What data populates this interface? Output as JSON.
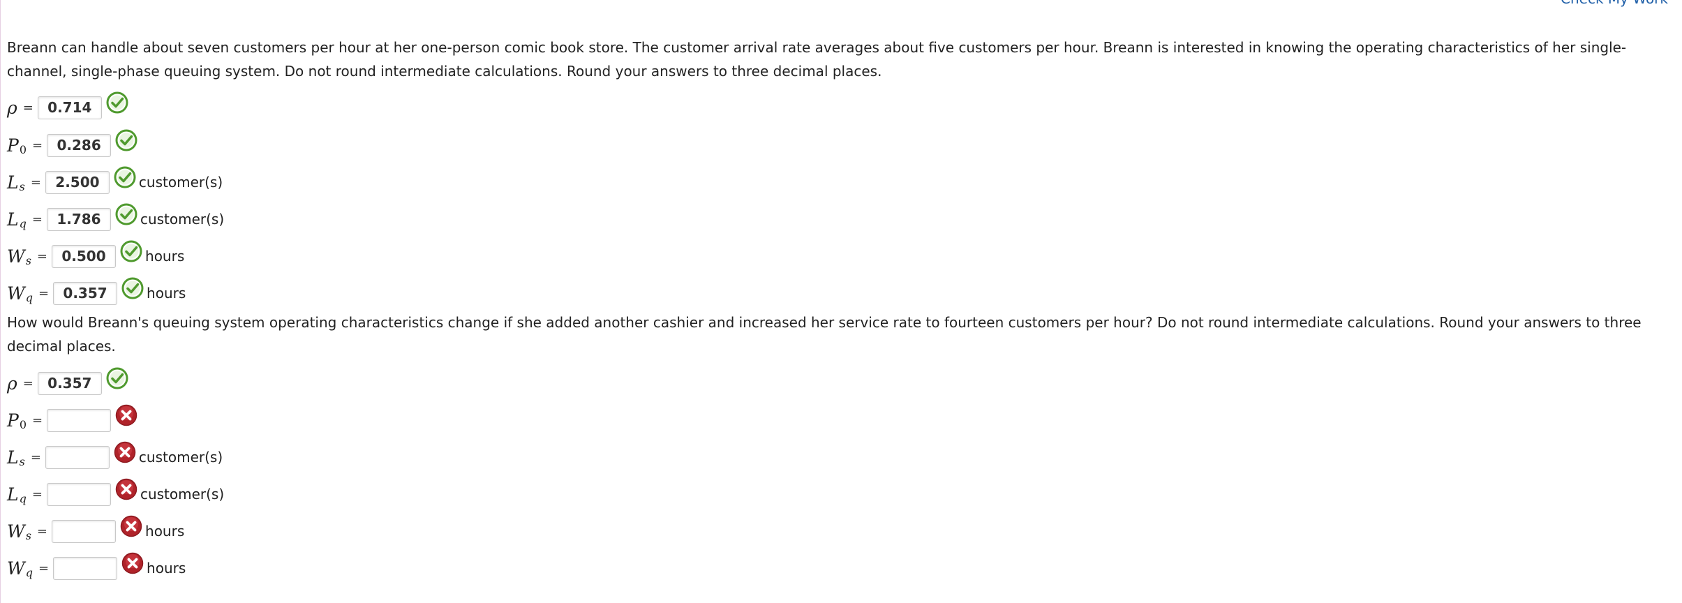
{
  "header": {
    "check_link": "Check My Work"
  },
  "part1": {
    "question": "Breann can handle about seven customers per hour at her one-person comic book store. The customer arrival rate averages about five customers per hour. Breann is interested in knowing the operating characteristics of her single-channel, single-phase queuing system. Do not round intermediate calculations. Round your answers to three decimal places.",
    "rows": [
      {
        "symbol": "ρ",
        "sub": "",
        "value": "0.714",
        "status": "correct",
        "unit": ""
      },
      {
        "symbol": "P",
        "sub": "0",
        "value": "0.286",
        "status": "correct",
        "unit": ""
      },
      {
        "symbol": "L",
        "sub": "s",
        "value": "2.500",
        "status": "correct",
        "unit": "customer(s)"
      },
      {
        "symbol": "L",
        "sub": "q",
        "value": "1.786",
        "status": "correct",
        "unit": "customer(s)"
      },
      {
        "symbol": "W",
        "sub": "s",
        "value": "0.500",
        "status": "correct",
        "unit": "hours"
      },
      {
        "symbol": "W",
        "sub": "q",
        "value": "0.357",
        "status": "correct",
        "unit": "hours"
      }
    ]
  },
  "part2": {
    "question": "How would Breann's queuing system operating characteristics change if she added another cashier and increased her service rate to fourteen customers per hour? Do not round intermediate calculations. Round your answers to three decimal places.",
    "rows": [
      {
        "symbol": "ρ",
        "sub": "",
        "value": "0.357",
        "status": "correct",
        "unit": ""
      },
      {
        "symbol": "P",
        "sub": "0",
        "value": "",
        "status": "incorrect",
        "unit": ""
      },
      {
        "symbol": "L",
        "sub": "s",
        "value": "",
        "status": "incorrect",
        "unit": "customer(s)"
      },
      {
        "symbol": "L",
        "sub": "q",
        "value": "",
        "status": "incorrect",
        "unit": "customer(s)"
      },
      {
        "symbol": "W",
        "sub": "s",
        "value": "",
        "status": "incorrect",
        "unit": "hours"
      },
      {
        "symbol": "W",
        "sub": "q",
        "value": "",
        "status": "incorrect",
        "unit": "hours"
      }
    ]
  },
  "equals_sign": "=",
  "colors": {
    "correct": "#4f9a2e",
    "incorrect": "#c0272d",
    "link": "#1f5fa8"
  },
  "icons": {
    "correct": "check-circle-icon",
    "incorrect": "x-circle-icon"
  }
}
